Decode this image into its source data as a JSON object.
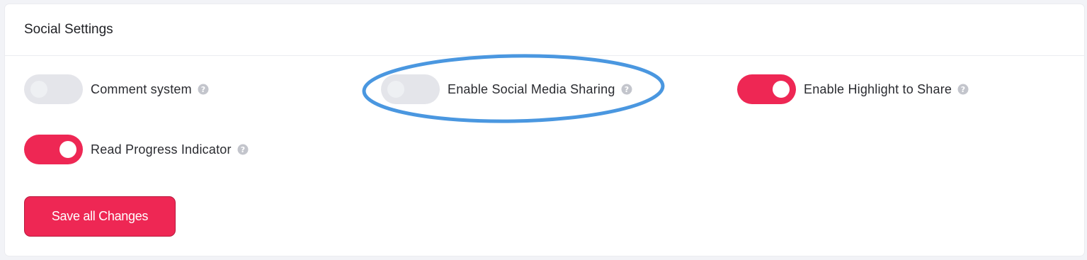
{
  "panel": {
    "title": "Social Settings"
  },
  "settings": [
    {
      "label": "Comment system",
      "enabled": false,
      "help_icon": "question-circle-icon"
    },
    {
      "label": "Enable Social Media Sharing",
      "enabled": false,
      "help_icon": "question-circle-icon"
    },
    {
      "label": "Enable Highlight to Share",
      "enabled": true,
      "help_icon": "question-circle-icon"
    },
    {
      "label": "Read Progress Indicator",
      "enabled": true,
      "help_icon": "question-circle-icon"
    }
  ],
  "actions": {
    "save_label": "Save all Changes"
  },
  "colors": {
    "accent": "#ee2754",
    "toggle_off": "#e4e5ea",
    "annotation": "#4a97e0"
  }
}
